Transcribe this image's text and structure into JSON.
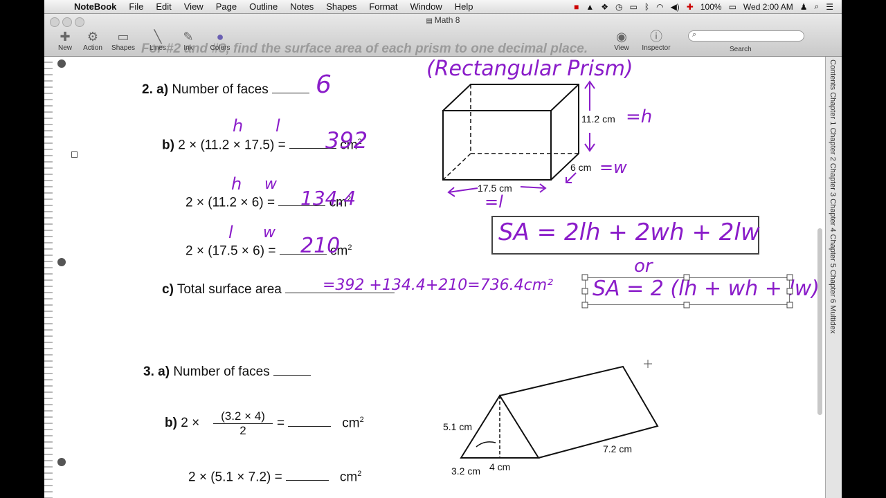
{
  "menubar": {
    "items": [
      "NoteBook",
      "File",
      "Edit",
      "View",
      "Page",
      "Outline",
      "Notes",
      "Shapes",
      "Format",
      "Window",
      "Help"
    ],
    "battery": "100%",
    "clock": "Wed 2:00 AM"
  },
  "window": {
    "title": "Math 8",
    "tools": [
      "New",
      "Action",
      "Shapes",
      "Lines",
      "Ink",
      "Colors",
      "View",
      "Inspector"
    ],
    "search_label": "Search"
  },
  "instruction": "For #2 and #3, find the surface area of each prism to one decimal place.",
  "side_tabs": "Contents  Chapter 1  Chapter 2  Chapter 3  Chapter 4  Chapter 5  Chapter 6  Multidex",
  "q2": {
    "a_number": "2.",
    "a_letter": "a)",
    "a_text": "Number of faces",
    "a_answer": "6",
    "b_letter": "b)",
    "b_expr": "2 × (11.2 × 17.5) =",
    "b_answer": "392",
    "unit": "cm",
    "line2_expr": "2 × (11.2 × 6) =",
    "line2_answer": "134.4",
    "line3_expr": "2 × (17.5 × 6) =",
    "line3_answer": "210",
    "c_letter": "c)",
    "c_text": "Total surface area",
    "c_answer": "=392 +134.4+210=736.4cm²",
    "ink_h1": "h",
    "ink_l1": "l",
    "ink_h2": "h",
    "ink_w2": "w",
    "ink_l3": "l",
    "ink_w3": "w"
  },
  "prism1": {
    "title_ink": "(Rectangular Prism)",
    "height_label": "11.2 cm",
    "height_ink": "=h",
    "depth_label": "6 cm",
    "depth_ink": "=w",
    "length_label": "17.5 cm",
    "length_ink": "=l",
    "formula1": "SA = 2lh + 2wh + 2lw",
    "or": "or",
    "formula2": "SA = 2 (lh + wh + lw)"
  },
  "q3": {
    "a_number": "3.",
    "a_letter": "a)",
    "a_text": "Number of faces",
    "b_letter": "b)",
    "b_num": "(3.2 × 4)",
    "b_den": "2",
    "b_pre": "2 ×",
    "b_post": "=",
    "unit": "cm",
    "line2_expr": "2 × (5.1 × 7.2) =",
    "side_label": "5.1 cm",
    "base_label": "3.2 cm",
    "height_label": "4 cm",
    "length_label": "7.2 cm"
  }
}
